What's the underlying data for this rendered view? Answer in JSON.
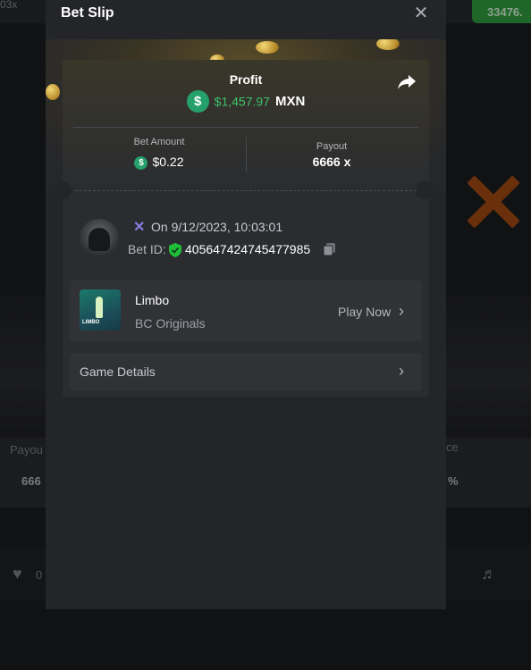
{
  "background": {
    "top_left_text": "03x",
    "top_right_value": "33476.",
    "left_label": "Payou",
    "left_value": "666",
    "right_label": "ce",
    "right_value": "%",
    "like_count": "0"
  },
  "modal": {
    "title": "Bet Slip",
    "profit": {
      "label": "Profit",
      "amount": "$1,457.97",
      "currency": "MXN"
    },
    "bet_amount": {
      "label": "Bet Amount",
      "value": "$0.22"
    },
    "payout": {
      "label": "Payout",
      "value": "6666 x"
    },
    "bet_info": {
      "date": "On 9/12/2023, 10:03:01",
      "bet_id_label": "Bet ID:",
      "bet_id": "405647424745477985"
    },
    "game": {
      "name": "Limbo",
      "provider": "BC Originals",
      "play_label": "Play Now",
      "thumb_tag": "LIMBO"
    },
    "details_label": "Game Details"
  },
  "colors": {
    "profit_green": "#3ec26a",
    "coin_green": "#26a06a",
    "accent_purple": "#8b7ce0"
  }
}
